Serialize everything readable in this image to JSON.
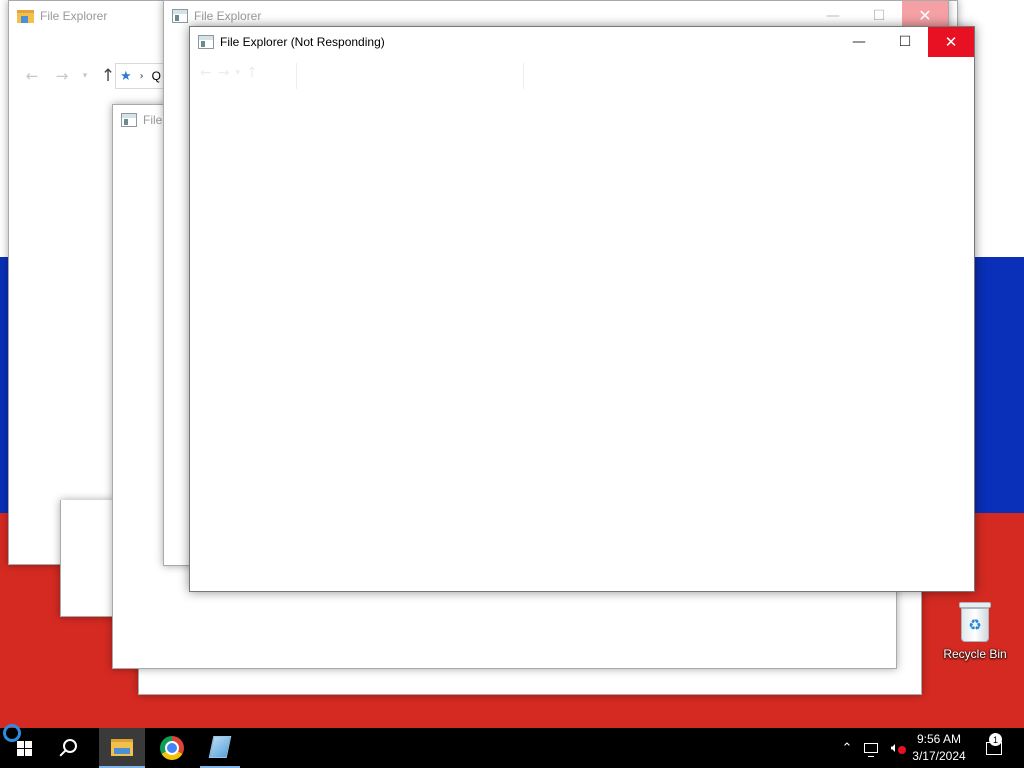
{
  "desktop": {
    "recycle_bin_label": "Recycle Bin"
  },
  "windows": {
    "back_explorer_1": {
      "title": "File Explorer",
      "address_text": "Q"
    },
    "back_explorer_2": {
      "title": "File Explorer"
    },
    "back_explorer_3": {
      "title": "File"
    },
    "main": {
      "title": "File Explorer (Not Responding)",
      "minimize_glyph": "—",
      "maximize_glyph": "☐",
      "close_glyph": "✕"
    }
  },
  "taskbar": {
    "items": [
      "start-icon",
      "search-icon",
      "file-explorer-icon",
      "chrome-icon",
      "notepad-icon"
    ],
    "tray": {
      "time": "9:56 AM",
      "date": "3/17/2024",
      "notification_count": "1"
    }
  },
  "colors": {
    "flag_white": "#ffffff",
    "flag_blue": "#0a2fb8",
    "flag_red": "#d42a22",
    "close_red": "#e81123",
    "taskbar": "#000000",
    "accent": "#7fb5e8"
  }
}
